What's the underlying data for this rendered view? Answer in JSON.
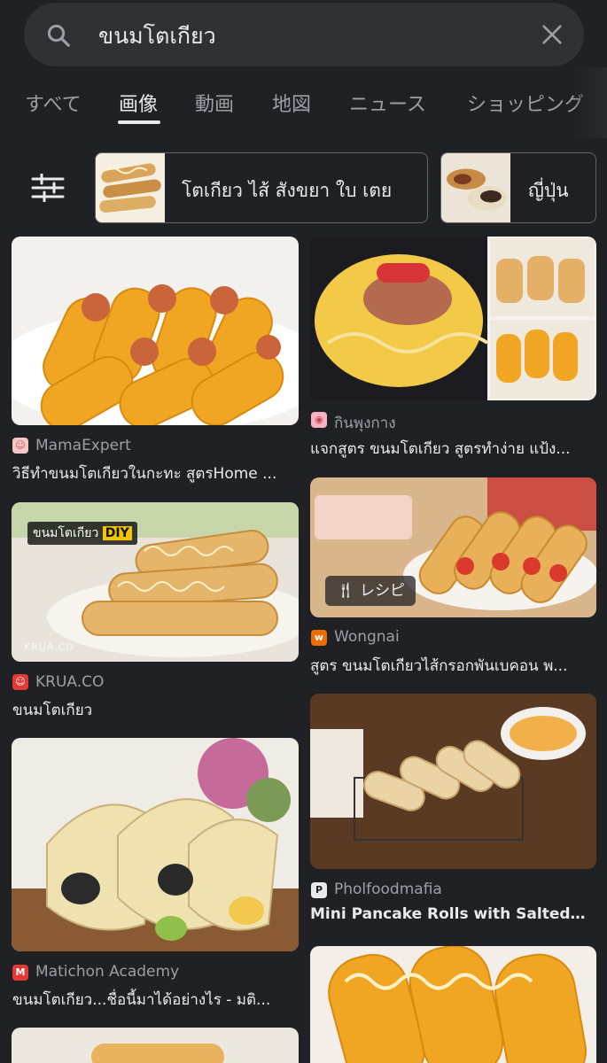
{
  "search": {
    "query": "ขนมโตเกียว"
  },
  "tabs": [
    {
      "label": "すべて",
      "active": false
    },
    {
      "label": "画像",
      "active": true
    },
    {
      "label": "動画",
      "active": false
    },
    {
      "label": "地図",
      "active": false
    },
    {
      "label": "ニュース",
      "active": false
    },
    {
      "label": "ショッピング",
      "active": false
    }
  ],
  "chips": [
    {
      "label": "โตเกียว ไส้ สังขยา ใบ เตย"
    },
    {
      "label": "ญี่ปุ่น"
    }
  ],
  "results": [
    {
      "source": "MamaExpert",
      "caption": "วิธีทำขนมโตเกียวในกะทะ สูตรHome ...",
      "favicon": "MamaExpert avatar"
    },
    {
      "source": "กินพุงกาง",
      "caption": "แจกสูตร ขนมโตเกียว สูตรทำง่าย แป้ง...",
      "favicon": "pig-icon"
    },
    {
      "source": "KRUA.CO",
      "caption": "ขนมโตเกียว",
      "image_label": "ขนมโตเกียว",
      "image_label_2": "DIY",
      "watermark": "KRUA.CO"
    },
    {
      "source": "Wongnai",
      "caption": "สูตร ขนมโตเกียวไส้กรอกพันเบคอน พ...",
      "badge": "レシピ",
      "favicon_letter": "w"
    },
    {
      "source": "Pholfoodmafia",
      "caption": "Mini Pancake Rolls with Salted Eg...",
      "favicon_letter": "P"
    },
    {
      "source": "Matichon Academy",
      "caption": "ขนมโตเกียว...ชื่อนี้มาได้อย่างไร - มติ...",
      "favicon_letter": "M"
    }
  ],
  "colors": {
    "background": "#202124",
    "surface": "#303134",
    "text": "#e8eaed",
    "muted": "#9aa0a6",
    "wongnai": "#ef6c00",
    "krua": "#e53935",
    "pinterest": "#e8eaed",
    "matichon": "#e53935"
  }
}
